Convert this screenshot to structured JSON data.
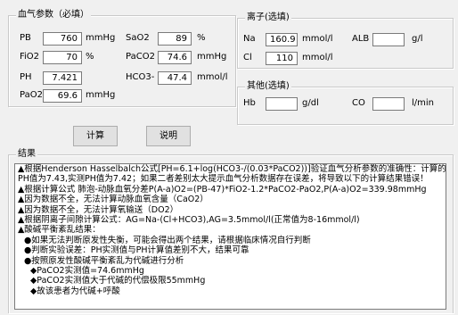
{
  "blood_gas": {
    "title": "血气参数（必填）",
    "fields": [
      {
        "label": "PB",
        "value": "760",
        "unit": "mmHg"
      },
      {
        "label": "FiO2",
        "value": "70",
        "unit": "%"
      },
      {
        "label": "PH",
        "value": "7.421",
        "unit": ""
      },
      {
        "label": "PaO2",
        "value": "69.6",
        "unit": "mmHg"
      },
      {
        "label": "SaO2",
        "value": "89",
        "unit": "%"
      },
      {
        "label": "PaCO2",
        "value": "74.6",
        "unit": "mmHg"
      },
      {
        "label": "HCO3-",
        "value": "47.4",
        "unit": "mmol/l"
      }
    ]
  },
  "ions": {
    "title": "离子(选填)",
    "fields": [
      {
        "label": "Na",
        "value": "160.9",
        "unit": "mmol/l"
      },
      {
        "label": "Cl",
        "value": "110",
        "unit": "mmol/l"
      },
      {
        "label": "ALB",
        "value": "",
        "unit": "g/l"
      }
    ]
  },
  "other": {
    "title": "其他(选填)",
    "fields": [
      {
        "label": "Hb",
        "value": "",
        "unit": "g/dl"
      },
      {
        "label": "CO",
        "value": "",
        "unit": "l/min"
      }
    ]
  },
  "buttons": {
    "calculate": "计算",
    "help": "说明"
  },
  "result": {
    "title": "结果",
    "lines": [
      {
        "level": 1,
        "text": "▲根据Henderson Hasselbalch公式[PH=6.1+log(HCO3-/(0.03*PaCO2))]验证血气分析参数的准确性：计算的"
      },
      {
        "level": 1,
        "text": "PH值为7.43,实测PH值为7.42；如果二者差别太大提示血气分析数据存在误差，将导致以下的计算结果错误！"
      },
      {
        "level": 1,
        "text": "▲根据计算公式 肺泡-动脉血氧分差P(A-a)O2=(PB-47)*FiO2-1.2*PaCO2-PaO2,P(A-a)O2=339.98mmHg"
      },
      {
        "level": 1,
        "text": "▲因为数据不全，无法计算动脉血氧含量（CaO2）"
      },
      {
        "level": 1,
        "text": "▲因为数据不全，无法计算氧输送（DO2）"
      },
      {
        "level": 1,
        "text": "▲根据阴离子间隙计算公式：AG=Na-(Cl+HCO3),AG=3.5mmol/l(正常值为8-16mmol/l)"
      },
      {
        "level": 1,
        "text": "▲酸碱平衡紊乱结果："
      },
      {
        "level": 2,
        "text": "●如果无法判断原发性失衡，可能会得出两个结果，请根据临床情况自行判断"
      },
      {
        "level": 2,
        "text": "●判断实验误差：PH实测值与PH计算值差别不大，结果可靠"
      },
      {
        "level": 2,
        "text": "●按照原发性酸碱平衡紊乱为代碱进行分析"
      },
      {
        "level": 3,
        "text": "◆PaCO2实测值=74.6mmHg"
      },
      {
        "level": 3,
        "text": "◆PaCO2实测值大于代碱的代偿极限55mmHg"
      },
      {
        "level": 3,
        "text": "◆故该患者为代碱+呼酸"
      }
    ]
  }
}
